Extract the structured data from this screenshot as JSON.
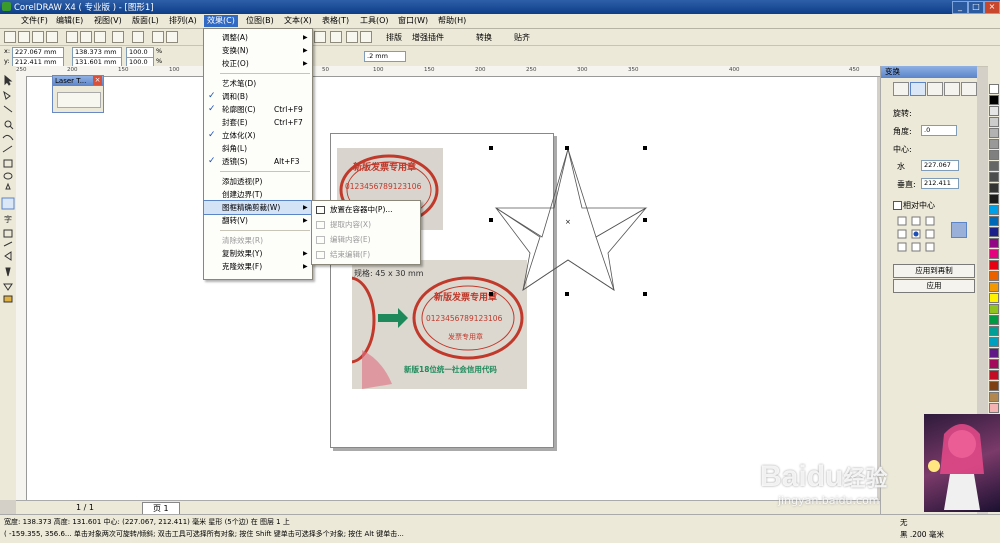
{
  "title": "CorelDRAW X4 ( 专业版 ) - [图形1]",
  "window_controls": {
    "min": "_",
    "max": "□",
    "close": "×"
  },
  "menubar": [
    "文件(F)",
    "编辑(E)",
    "视图(V)",
    "版面(L)",
    "排列(A)",
    "效果(C)",
    "位图(B)",
    "文本(X)",
    "表格(T)",
    "工具(O)",
    "窗口(W)",
    "帮助(H)"
  ],
  "toolbar_right": [
    "排版",
    "增强插件",
    "转换",
    "贴齐"
  ],
  "property_bar": {
    "x": "227.067 mm",
    "y": "212.411 mm",
    "w": "138.373 mm",
    "h": "131.601 mm",
    "sx": "100.0",
    "sy": "100.0",
    "unit": "%",
    "outline": ".2 mm"
  },
  "ruler_h_labels": [
    "250",
    "200",
    "150",
    "100",
    "50",
    "0",
    "50",
    "100",
    "150",
    "200",
    "250",
    "300",
    "350",
    "400",
    "450"
  ],
  "laser_panel": {
    "title": "Laser T..."
  },
  "effects_menu": [
    {
      "label": "调整(A)",
      "arrow": true
    },
    {
      "label": "变换(N)",
      "arrow": true
    },
    {
      "label": "校正(O)",
      "arrow": true
    },
    {
      "sep": true
    },
    {
      "label": "艺术笔(D)"
    },
    {
      "label": "调和(B)",
      "check": true
    },
    {
      "label": "轮廓图(C)",
      "shortcut": "Ctrl+F9",
      "check": true
    },
    {
      "label": "封套(E)",
      "shortcut": "Ctrl+F7"
    },
    {
      "label": "立体化(X)",
      "check": true
    },
    {
      "label": "斜角(L)"
    },
    {
      "label": "透镜(S)",
      "shortcut": "Alt+F3",
      "check": true
    },
    {
      "sep": true
    },
    {
      "label": "添加透视(P)"
    },
    {
      "label": "创建边界(T)"
    },
    {
      "label": "图框精确剪裁(W)",
      "arrow": true,
      "highlight": true
    },
    {
      "label": "翻转(V)",
      "arrow": true
    },
    {
      "sep": true
    },
    {
      "label": "清除效果(R)",
      "disabled": true
    },
    {
      "label": "复制效果(Y)",
      "arrow": true
    },
    {
      "label": "克隆效果(F)",
      "arrow": true
    }
  ],
  "submenu": [
    {
      "label": "放置在容器中(P)...",
      "disabled": false
    },
    {
      "label": "提取内容(X)",
      "disabled": true
    },
    {
      "label": "编辑内容(E)",
      "disabled": true
    },
    {
      "label": "结束编辑(F)",
      "disabled": true
    }
  ],
  "canvas_text": {
    "size_label": "规格: 45 x 30 mm",
    "stamp_ring": "新版发票专用章",
    "stamp_num": "0123456789123106",
    "stamp_bottom": "发票专用章",
    "photo_caption": "新版18位统一社会信用代码"
  },
  "dock": {
    "title": "变换",
    "rotate_label": "旋转:",
    "angle_label": "角度:",
    "angle_value": ".0",
    "center_label": "中心:",
    "h_label": "水",
    "h_value": "227.067",
    "v_label": "垂直:",
    "v_value": "212.411",
    "relative_label": "相对中心",
    "apply_copy": "应用到再制",
    "apply": "应用"
  },
  "page_tabs": {
    "count": "1 / 1",
    "tab": "页 1"
  },
  "status": {
    "line1": "宽度: 138.373  高度: 131.601  中心: (227.067, 212.411)  毫米          星形 (5个边) 在 图层 1 上",
    "line2": "( -159.355, 356.6...  单击对象两次可旋转/倾斜; 双击工具可选择所有对象; 按住 Shift 键单击可选择多个对象; 按住 Alt 键单击...",
    "fill_label": "无",
    "outline_label": "黑  .200 毫米"
  },
  "watermark": {
    "brand": "Bai",
    "paw": "du",
    "cn": "经验",
    "url": "jingyan.baidu.com"
  },
  "palette_colors": [
    "#ffffff",
    "#000000",
    "#e5e5e5",
    "#cccccc",
    "#b2b2b2",
    "#999999",
    "#808080",
    "#666666",
    "#4d4d4d",
    "#333333",
    "#1a1a1a",
    "#00a0e9",
    "#0068b7",
    "#1d2088",
    "#920783",
    "#e4007f",
    "#e60012",
    "#eb6100",
    "#f39800",
    "#fff100",
    "#8fc31f",
    "#009944",
    "#009e96",
    "#00a0c1",
    "#601986",
    "#a40b5d",
    "#c30d23",
    "#7e3f13",
    "#b28850",
    "#f5b2b2",
    "#fcc800",
    "#cfdb00",
    "#22ac38",
    "#0075a9",
    "#8c97cb"
  ]
}
